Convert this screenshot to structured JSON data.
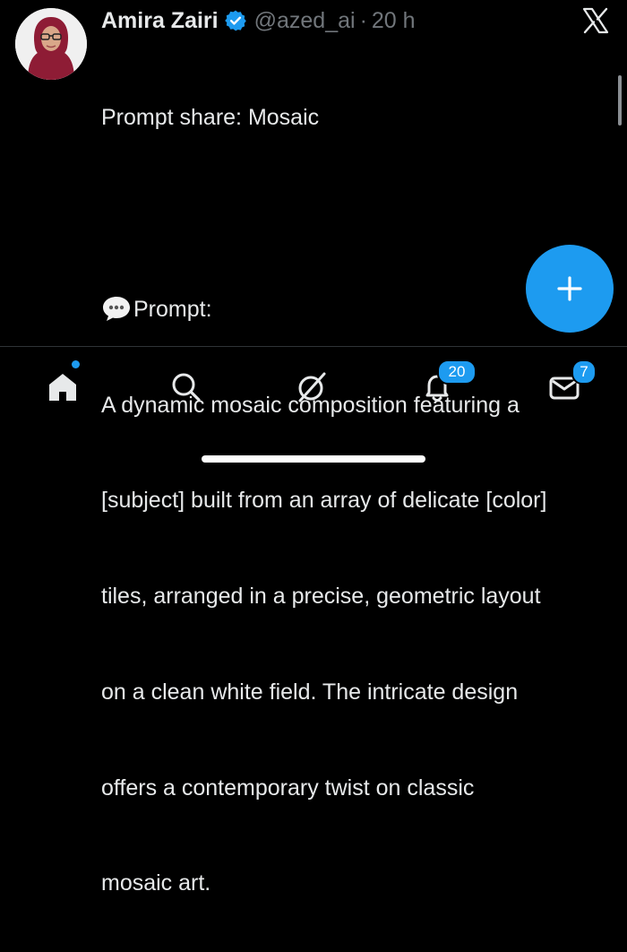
{
  "post": {
    "author_name": "Amira Zairi",
    "handle": "@azed_ai",
    "separator": "·",
    "time": "20 h",
    "lines": [
      "Prompt share: Mosaic",
      "",
      "Prompt:",
      "A dynamic mosaic composition featuring a",
      "[subject] built from an array of delicate [color]",
      "tiles, arranged in a precise, geometric layout",
      "on a clean white field. The intricate design",
      "offers a contemporary twist on classic",
      "mosaic art."
    ]
  },
  "icons": {
    "verified": "verified-badge-icon",
    "close": "x-logo-icon",
    "prompt_bubble": "speech-bubble-icon",
    "compose": "plus-icon",
    "nav": [
      "home-icon",
      "search-icon",
      "grok-icon",
      "notifications-icon",
      "messages-icon"
    ]
  },
  "nav": {
    "notifications_badge": "20",
    "messages_badge": "7",
    "home_has_dot": true
  },
  "colors": {
    "background": "#000000",
    "text": "#e7e9ea",
    "muted": "#71767b",
    "accent": "#1d9bf0"
  }
}
